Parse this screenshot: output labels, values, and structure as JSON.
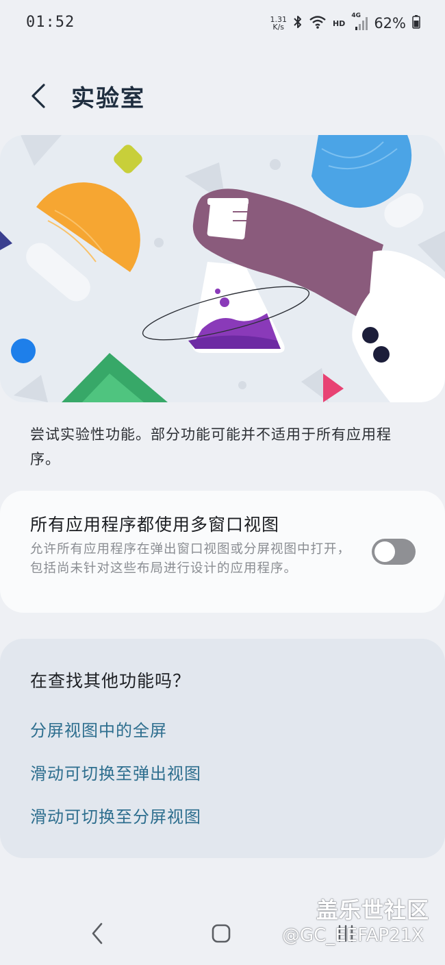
{
  "status_bar": {
    "time": "01:52",
    "net_speed_value": "1.31",
    "net_speed_unit": "K/s",
    "hd_label": "HD",
    "network_label": "4G",
    "battery": "62%"
  },
  "header": {
    "title": "实验室"
  },
  "description": "尝试实验性功能。部分功能可能并不适用于所有应用程序。",
  "setting": {
    "title": "所有应用程序都使用多窗口视图",
    "description": "允许所有应用程序在弹出窗口视图或分屏视图中打开，包括尚未针对这些布局进行设计的应用程序。",
    "enabled": false
  },
  "looking_for": {
    "title": "在查找其他功能吗？",
    "links": [
      "分屏视图中的全屏",
      "滑动可切换至弹出视图",
      "滑动可切换至分屏视图"
    ]
  },
  "watermark": {
    "brand": "盖乐世社区",
    "user": "@GC_EEFAP21X"
  },
  "icons": {
    "back": "chevron-left-icon",
    "bluetooth": "bluetooth-icon",
    "wifi": "wifi-icon",
    "signal": "signal-icon",
    "battery": "battery-icon",
    "illustration": "lab-flask-illustration"
  },
  "colors": {
    "background": "#eef0f4",
    "card": "#fafbfc",
    "link": "#2d6e8e",
    "toggle_off": "#8f9094"
  }
}
